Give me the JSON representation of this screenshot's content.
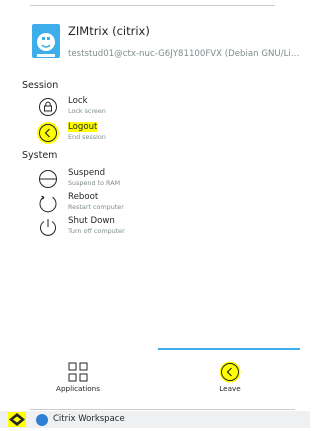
{
  "user": {
    "name": "ZIMtrix (citrix)",
    "host": "teststud01@ctx-nuc-G6JY81100FVX (Debian GNU/Lin..."
  },
  "sections": {
    "session": "Session",
    "system": "System"
  },
  "session_items": [
    {
      "label": "Lock",
      "sublabel": "Lock screen",
      "icon": "lock-icon"
    },
    {
      "label": "Logout",
      "sublabel": "End session",
      "icon": "logout-icon",
      "highlighted": true
    }
  ],
  "system_items": [
    {
      "label": "Suspend",
      "sublabel": "Suspend to RAM",
      "icon": "suspend-icon"
    },
    {
      "label": "Reboot",
      "sublabel": "Restart computer",
      "icon": "reboot-icon"
    },
    {
      "label": "Shut Down",
      "sublabel": "Turn off computer",
      "icon": "shutdown-icon"
    }
  ],
  "tabs": [
    {
      "label": "Applications",
      "icon": "applications-grid-icon",
      "active": false
    },
    {
      "label": "Leave",
      "icon": "leave-icon",
      "active": true
    }
  ],
  "taskbar": {
    "task_label": "Citrix Workspace",
    "task_icon": "citrix-workspace-icon",
    "launcher_icon": "application-launcher-icon"
  },
  "colors": {
    "accent": "#3daee9",
    "highlight": "#ffff00",
    "text": "#232627",
    "subtext": "#7f8c8d"
  }
}
